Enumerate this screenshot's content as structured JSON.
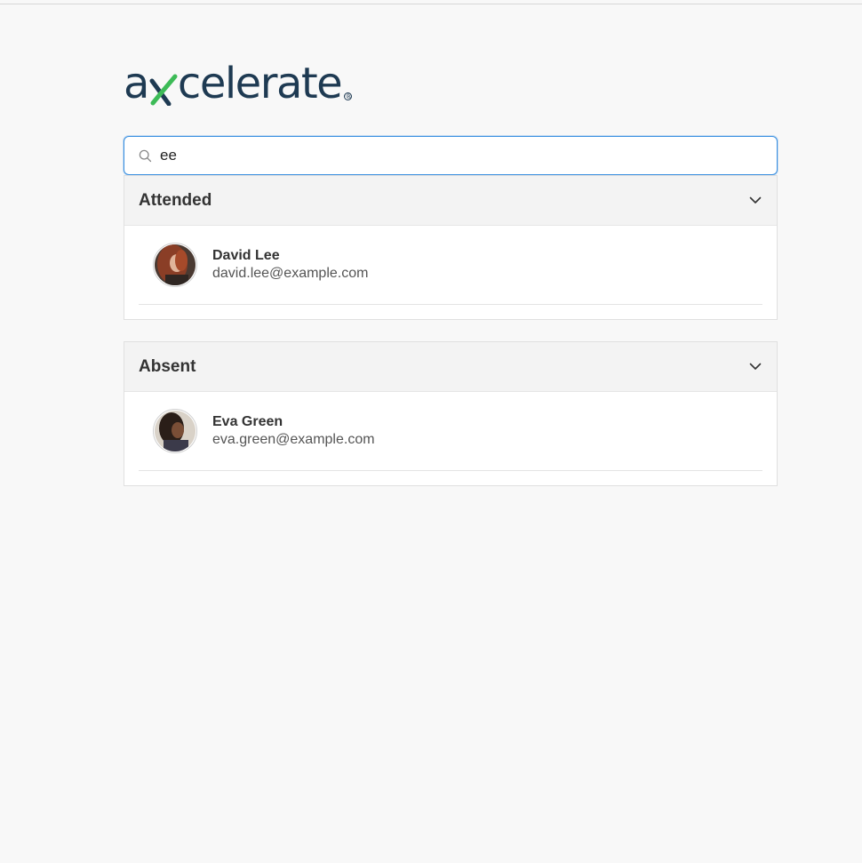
{
  "brand": {
    "logo_text_before": "a",
    "logo_text_after": "celerate",
    "logo_mark": "x-check-icon",
    "registered": "®",
    "colors": {
      "navy": "#1e3a52",
      "green": "#3dbb57"
    }
  },
  "search": {
    "value": "ee",
    "placeholder": ""
  },
  "groups": [
    {
      "title": "Attended",
      "people": [
        {
          "name": "David Lee",
          "email": "david.lee@example.com"
        }
      ]
    },
    {
      "title": "Absent",
      "people": [
        {
          "name": "Eva Green",
          "email": "eva.green@example.com"
        }
      ]
    }
  ],
  "colors": {
    "accent": "#3a8fe0",
    "header_bg": "#f3f3f3",
    "page_bg": "#f8f8f8"
  }
}
